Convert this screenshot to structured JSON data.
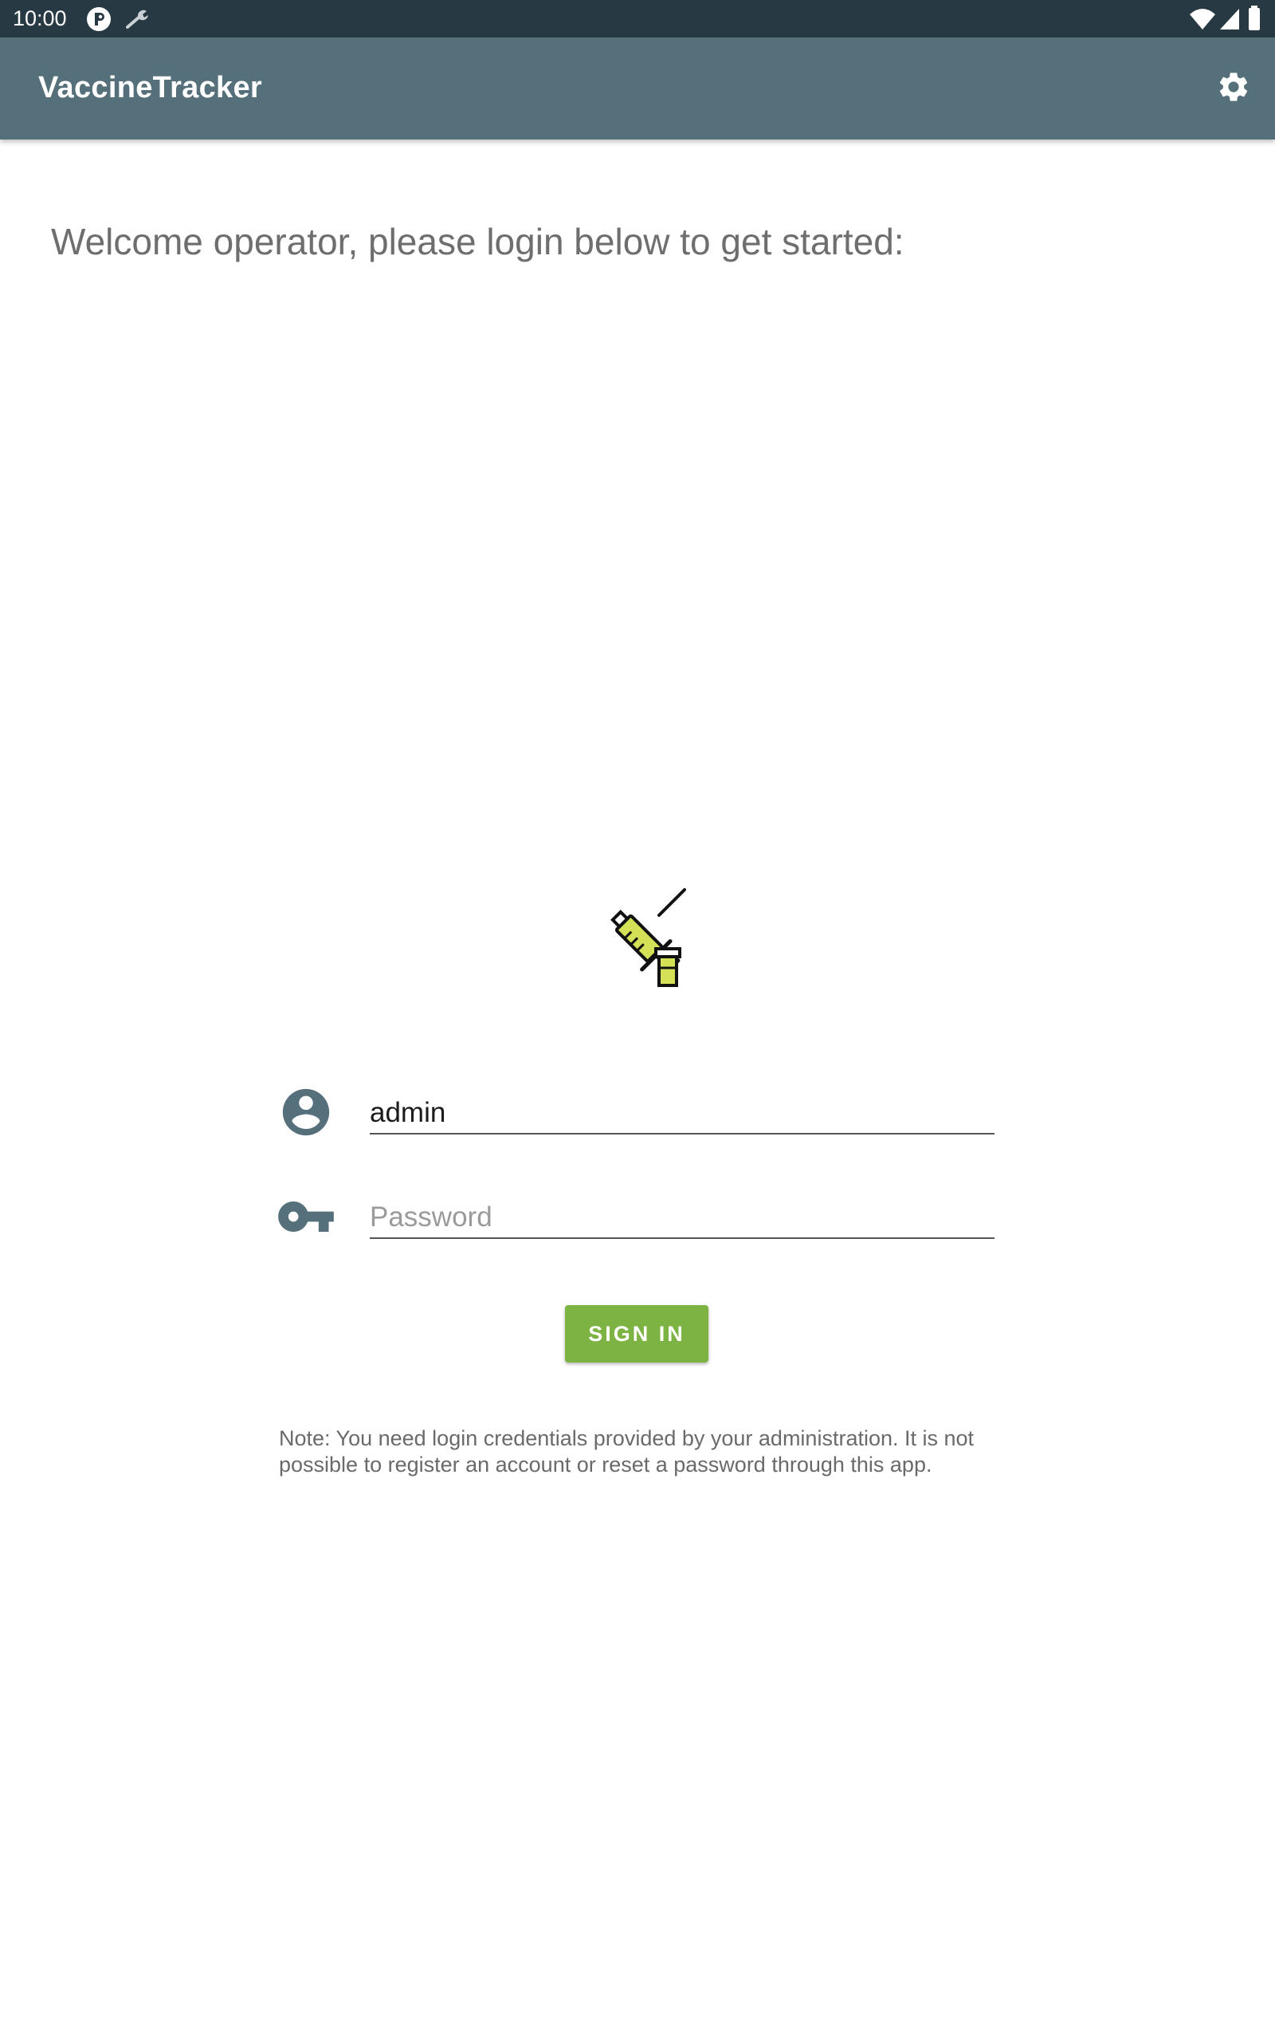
{
  "status_bar": {
    "time": "10:00",
    "left_icons": [
      "p-icon",
      "wrench-icon"
    ],
    "right_icons": [
      "wifi-icon",
      "signal-icon",
      "battery-icon"
    ]
  },
  "app_bar": {
    "title": "VaccineTracker",
    "settings_icon": "gear-icon"
  },
  "welcome": {
    "text": "Welcome operator, please login below to get started:"
  },
  "logo": {
    "icon": "syringe-vial-icon"
  },
  "form": {
    "username": {
      "icon": "account-circle-icon",
      "value": "admin",
      "placeholder": ""
    },
    "password": {
      "icon": "key-icon",
      "value": "",
      "placeholder": "Password"
    },
    "sign_in_label": "SIGN IN"
  },
  "note": {
    "text": "Note: You need login credentials provided by your administration. It is not possible to register an account or reset a password through this app."
  },
  "colors": {
    "status_bar": "#273a43",
    "app_bar": "#56707b",
    "accent_button": "#7cb342",
    "icon": "#56707b",
    "welcome_text": "#6e6e6e"
  }
}
